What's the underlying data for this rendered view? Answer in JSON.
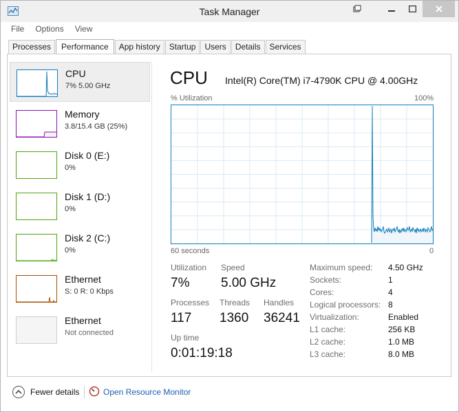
{
  "window": {
    "title": "Task Manager"
  },
  "menu": [
    "File",
    "Options",
    "View"
  ],
  "tabs": [
    "Processes",
    "Performance",
    "App history",
    "Startup",
    "Users",
    "Details",
    "Services"
  ],
  "active_tab": "Performance",
  "sidebar": [
    {
      "name": "CPU",
      "sub": "7% 5.00 GHz",
      "color": "#117dbb"
    },
    {
      "name": "Memory",
      "sub": "3.8/15.4 GB (25%)",
      "color": "#8b12ae"
    },
    {
      "name": "Disk 0 (E:)",
      "sub": "0%",
      "color": "#4da60c"
    },
    {
      "name": "Disk 1 (D:)",
      "sub": "0%",
      "color": "#4da60c"
    },
    {
      "name": "Disk 2 (C:)",
      "sub": "0%",
      "color": "#4da60c"
    },
    {
      "name": "Ethernet",
      "sub": "S: 0 R: 0 Kbps",
      "color": "#a74f01"
    },
    {
      "name": "Ethernet",
      "sub": "Not connected",
      "color": "#cfcfcf"
    }
  ],
  "main": {
    "title": "CPU",
    "processor": "Intel(R) Core(TM) i7-4790K CPU @ 4.00GHz",
    "graph": {
      "y_label": "% Utilization",
      "y_max_label": "100%",
      "x_label": "60 seconds",
      "x_end_label": "0",
      "accent": "#117dbb",
      "fill": "#f1f6fa",
      "utilization_series": [
        0,
        0,
        0,
        0,
        0,
        0,
        0,
        0,
        0,
        0,
        0,
        0,
        0,
        0,
        0,
        0,
        0,
        0,
        0,
        0,
        0,
        0,
        0,
        0,
        0,
        0,
        0,
        0,
        0,
        0,
        0,
        0,
        0,
        0,
        0,
        0,
        0,
        0,
        0,
        0,
        0,
        0,
        0,
        0,
        0,
        0,
        0,
        0,
        0,
        0,
        0,
        0,
        0,
        0,
        0,
        0,
        0,
        0,
        0,
        0,
        0,
        0,
        0,
        0,
        0,
        0,
        0,
        0,
        0,
        0,
        0,
        0,
        0,
        0,
        0,
        0,
        0,
        0,
        0,
        0,
        0,
        0,
        0,
        0,
        0,
        0,
        0,
        0,
        0,
        0,
        0,
        0,
        0,
        0,
        0,
        0,
        0,
        0,
        0,
        0,
        0,
        0,
        0,
        0,
        0,
        0,
        0,
        0,
        0,
        0,
        0,
        0,
        0,
        0,
        0,
        0,
        0,
        0,
        0,
        0,
        0,
        0,
        0,
        0,
        0,
        0,
        0,
        0,
        0,
        0,
        0,
        0,
        0,
        0,
        0,
        0,
        0,
        0,
        0,
        0,
        0,
        0,
        0,
        0,
        0,
        0,
        0,
        0,
        0,
        0,
        0,
        0,
        0,
        0,
        0,
        0,
        0,
        0,
        0,
        0,
        0,
        0,
        0,
        0,
        0,
        0,
        0,
        0,
        0,
        0,
        0,
        0,
        0,
        0,
        0,
        0,
        0,
        0,
        0,
        0,
        0,
        0,
        0,
        0,
        0,
        0,
        0,
        0,
        0,
        0,
        0,
        0,
        0,
        0,
        0,
        0,
        0,
        0,
        0,
        0,
        0,
        0,
        0,
        0,
        0,
        0,
        0,
        0,
        0,
        0,
        0,
        0,
        0,
        0,
        0,
        0,
        0,
        0,
        0,
        0,
        0,
        0,
        0,
        0,
        0,
        0,
        0,
        0,
        0,
        0,
        0,
        0,
        0,
        0,
        0,
        0,
        0,
        0,
        0,
        0,
        0,
        0,
        0,
        0,
        0,
        0,
        0,
        0,
        0,
        0,
        0,
        0,
        0,
        0,
        0,
        0,
        0,
        0,
        0,
        0,
        0,
        0,
        0,
        0,
        0,
        0,
        0,
        0,
        0,
        0,
        0,
        0,
        0,
        0,
        0,
        0,
        0,
        0,
        0,
        0,
        0,
        0,
        0,
        0,
        0,
        0,
        0,
        0,
        0,
        0,
        0,
        0,
        100,
        20,
        10,
        8,
        11,
        9,
        10,
        8,
        12,
        9,
        11,
        9,
        10,
        8,
        9,
        10,
        12,
        8,
        7,
        8,
        9,
        10,
        8,
        9,
        11,
        8,
        9,
        10,
        7,
        9,
        10,
        9,
        11,
        8,
        9,
        10,
        12,
        9,
        8,
        10,
        7,
        9,
        8,
        10,
        9,
        11,
        8,
        10,
        9,
        8,
        10,
        11,
        9,
        10,
        12,
        8,
        9,
        10,
        8,
        11,
        10,
        9,
        8,
        10,
        7,
        11,
        9,
        10,
        8,
        9,
        10,
        8,
        9,
        10,
        8,
        11,
        9,
        8,
        10,
        9,
        8,
        11,
        10,
        9,
        8,
        10,
        12,
        9,
        10
      ]
    },
    "stats": {
      "utilization": {
        "label": "Utilization",
        "value": "7%"
      },
      "speed": {
        "label": "Speed",
        "value": "5.00 GHz"
      },
      "processes": {
        "label": "Processes",
        "value": "117"
      },
      "threads": {
        "label": "Threads",
        "value": "1360"
      },
      "handles": {
        "label": "Handles",
        "value": "36241"
      },
      "uptime": {
        "label": "Up time",
        "value": "0:01:19:18"
      }
    },
    "specs": [
      {
        "label": "Maximum speed:",
        "value": "4.50 GHz"
      },
      {
        "label": "Sockets:",
        "value": "1"
      },
      {
        "label": "Cores:",
        "value": "4"
      },
      {
        "label": "Logical processors:",
        "value": "8"
      },
      {
        "label": "Virtualization:",
        "value": "Enabled"
      },
      {
        "label": "L1 cache:",
        "value": "256 KB"
      },
      {
        "label": "L2 cache:",
        "value": "1.0 MB"
      },
      {
        "label": "L3 cache:",
        "value": "8.0 MB"
      }
    ]
  },
  "footer": {
    "fewer_details": "Fewer details",
    "resource_monitor": "Open Resource Monitor"
  }
}
